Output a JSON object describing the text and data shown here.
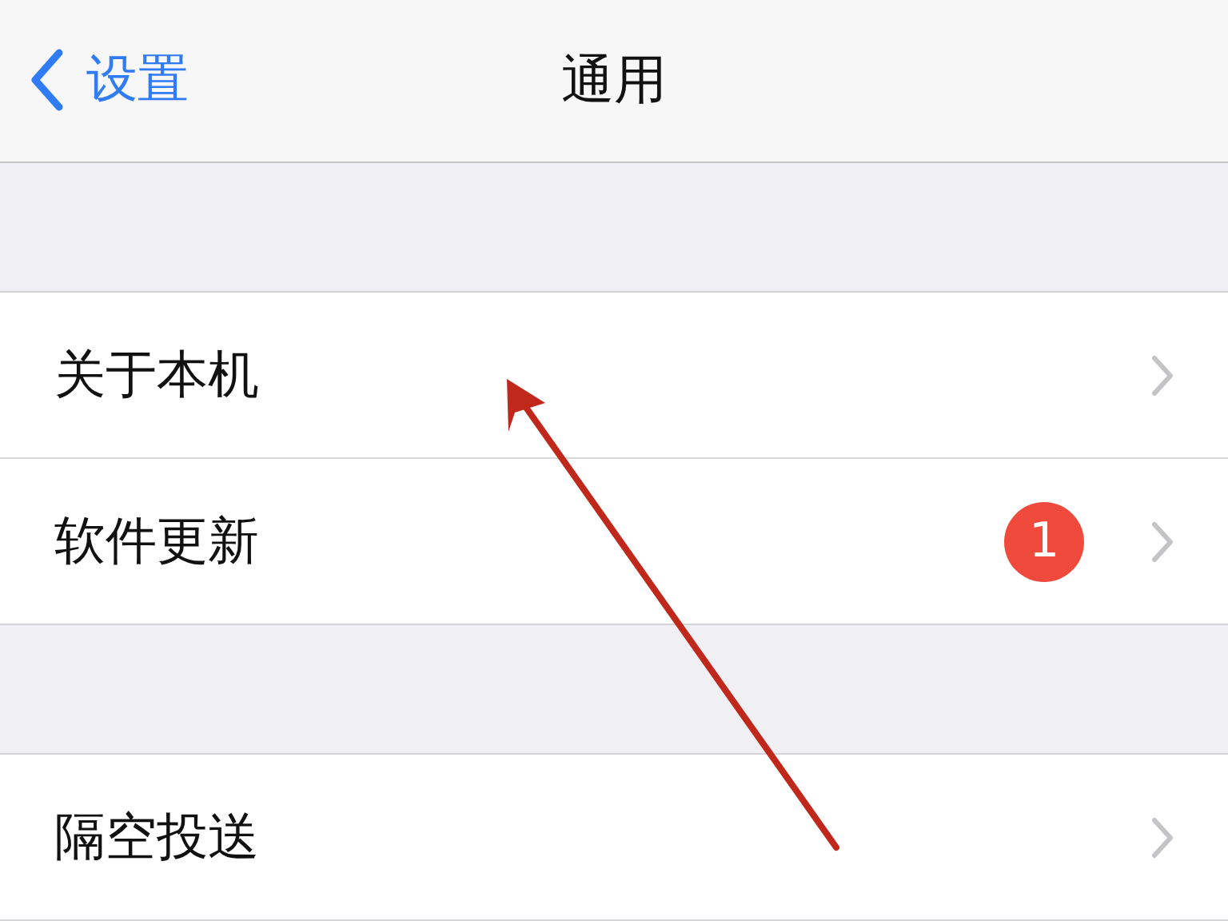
{
  "nav": {
    "back_label": "设置",
    "title": "通用"
  },
  "groups": [
    {
      "items": [
        {
          "label": "关于本机"
        },
        {
          "label": "软件更新",
          "badge": "1"
        }
      ]
    },
    {
      "items": [
        {
          "label": "隔空投送"
        }
      ]
    }
  ]
}
